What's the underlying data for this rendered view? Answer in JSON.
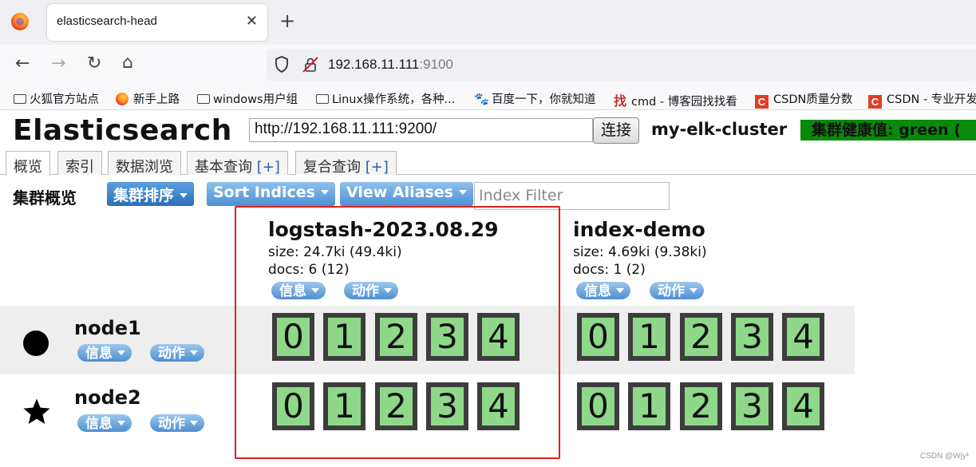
{
  "browser": {
    "tab_title": "elasticsearch-head",
    "tab_close": "✕",
    "new_tab": "+",
    "url_host": "192.168.11.111",
    "url_port": ":9100",
    "nav_back": "←",
    "nav_forward": "→",
    "nav_reload": "↻",
    "nav_home": "⌂",
    "bookmarks": [
      {
        "label": "火狐官方站点",
        "icon": "folder-icon"
      },
      {
        "label": "新手上路",
        "icon": "firefox-icon"
      },
      {
        "label": "windows用户组",
        "icon": "folder-icon"
      },
      {
        "label": "Linux操作系统，各种...",
        "icon": "folder-icon"
      },
      {
        "label": "百度一下，你就知道",
        "icon": "baidu-paw-icon"
      },
      {
        "label": "cmd - 博客园找找看",
        "icon": "zhao-icon"
      },
      {
        "label": "CSDN质量分数",
        "icon": "csdn-icon"
      },
      {
        "label": "CSDN - 专业开发",
        "icon": "csdn-icon"
      }
    ],
    "bm_glyphs": {
      "baidu": "🐾",
      "zhao": "找",
      "csdn": "C"
    }
  },
  "app": {
    "title": "Elasticsearch",
    "connect_url": "http://192.168.11.111:9200/",
    "connect_label": "连接",
    "cluster_name": "my-elk-cluster",
    "health_label": "集群健康值: green (",
    "health_color": "#0a8a0a",
    "tabs": [
      {
        "label": "概览",
        "plus": ""
      },
      {
        "label": "索引",
        "plus": ""
      },
      {
        "label": "数据浏览",
        "plus": ""
      },
      {
        "label": "基本查询",
        "plus": "[+]"
      },
      {
        "label": "复合查询",
        "plus": "[+]"
      }
    ],
    "overview_title": "集群概览",
    "sort_cluster_label": "集群排序",
    "sort_indices_label": "Sort Indices",
    "view_aliases_label": "View Aliases",
    "index_filter_placeholder": "Index Filter",
    "info_label": "信息",
    "action_label": "动作",
    "indices": [
      {
        "name": "logstash-2023.08.29",
        "size": "size: 24.7ki (49.4ki)",
        "docs": "docs: 6 (12)"
      },
      {
        "name": "index-demo",
        "size": "size: 4.69ki (9.38ki)",
        "docs": "docs: 1 (2)"
      }
    ],
    "nodes": [
      {
        "name": "node1",
        "icon": "master-dot-icon",
        "shards": {
          "logstash": [
            "0",
            "1",
            "2",
            "3",
            "4"
          ],
          "demo": [
            "0",
            "1",
            "2",
            "3",
            "4"
          ]
        }
      },
      {
        "name": "node2",
        "icon": "star-icon",
        "shards": {
          "logstash": [
            "0",
            "1",
            "2",
            "3",
            "4"
          ],
          "demo": [
            "0",
            "1",
            "2",
            "3",
            "4"
          ]
        }
      }
    ],
    "shard_color": "#8fd88a",
    "highlight_color": "#e0201b"
  },
  "watermark": "CSDN @Wjy¹"
}
